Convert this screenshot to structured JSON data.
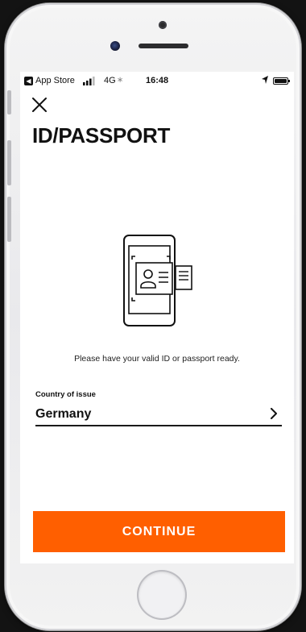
{
  "status_bar": {
    "back_app": "App Store",
    "network": "4G",
    "time": "16:48"
  },
  "header": {
    "title": "ID/PASSPORT"
  },
  "icons": {
    "close": "close-icon",
    "illustration": "phone-id-card-scan-icon",
    "chevron": "chevron-right-icon"
  },
  "main": {
    "instruction": "Please have your valid ID or passport ready."
  },
  "country_field": {
    "label": "Country of issue",
    "value": "Germany"
  },
  "footer": {
    "continue_label": "CONTINUE"
  },
  "colors": {
    "accent": "#ff5f00",
    "text": "#111111",
    "background": "#ffffff"
  }
}
